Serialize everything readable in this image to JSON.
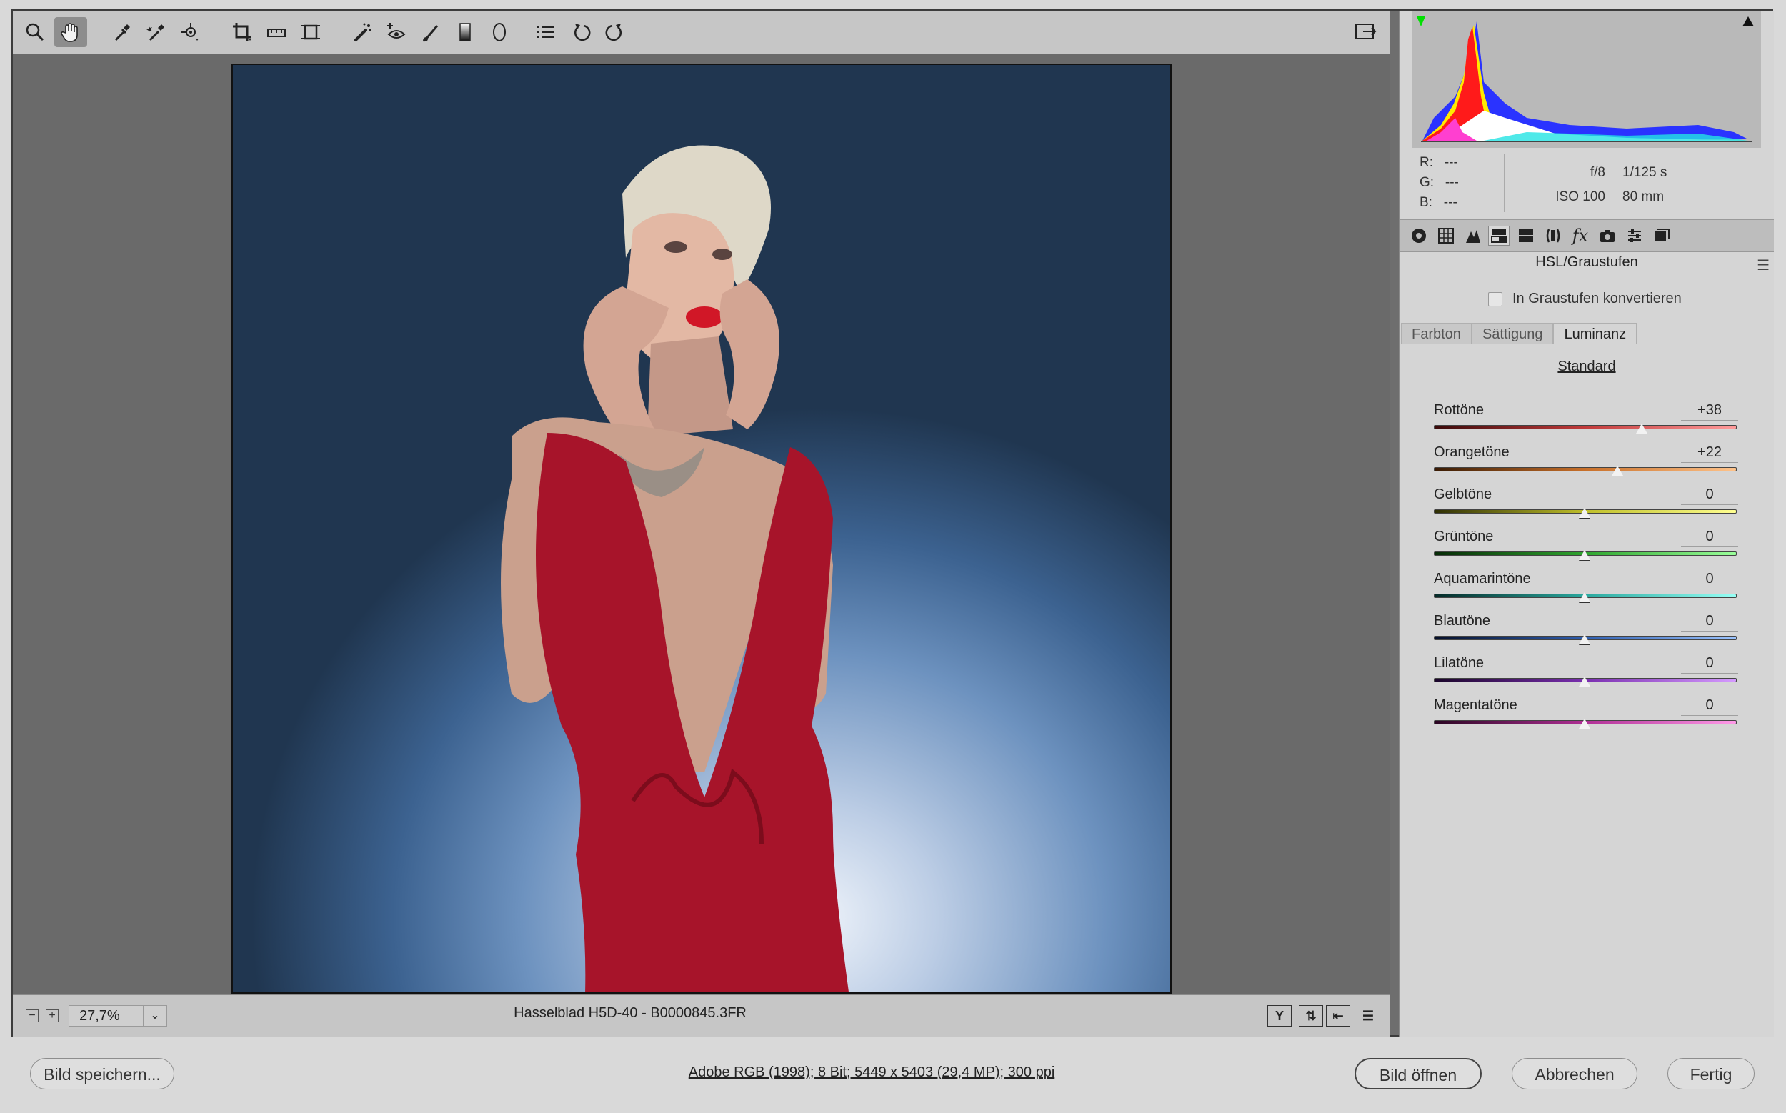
{
  "toolbar": {
    "tools": [
      {
        "icon": "zoom-icon"
      },
      {
        "icon": "hand-icon"
      },
      {
        "icon": "white-balance-icon"
      },
      {
        "icon": "color-sampler-icon"
      },
      {
        "icon": "targeted-adjustment-icon"
      },
      {
        "icon": "crop-icon"
      },
      {
        "icon": "straighten-icon"
      },
      {
        "icon": "transform-icon"
      },
      {
        "icon": "spot-removal-icon"
      },
      {
        "icon": "red-eye-icon"
      },
      {
        "icon": "adjustment-brush-icon"
      },
      {
        "icon": "graduated-filter-icon"
      },
      {
        "icon": "radial-filter-icon"
      },
      {
        "icon": "preferences-icon"
      },
      {
        "icon": "rotate-left-icon"
      },
      {
        "icon": "rotate-right-icon"
      }
    ]
  },
  "status": {
    "zoom": "27,7%",
    "filename": "Hasselblad H5D-40  -  B0000845.3FR"
  },
  "info": {
    "r_label": "R:",
    "r_val": "---",
    "g_label": "G:",
    "g_val": "---",
    "b_label": "B:",
    "b_val": "---",
    "aperture": "f/8",
    "shutter": "1/125 s",
    "iso": "ISO 100",
    "focal": "80 mm"
  },
  "panel": {
    "title": "HSL/Graustufen",
    "grayscale_label": "In Graustufen konvertieren",
    "tabs": [
      "Farbton",
      "Sättigung",
      "Luminanz"
    ],
    "active_tab": "Luminanz",
    "standard_label": "Standard",
    "sliders": [
      {
        "label": "Rottöne",
        "value": "+38",
        "amount": 38,
        "gradient": "linear-gradient(90deg,#3a0a0a,#c23a3a,#ff9a9a)"
      },
      {
        "label": "Orangetöne",
        "value": "+22",
        "amount": 22,
        "gradient": "linear-gradient(90deg,#3a1c05,#c8702a,#ffc38a)"
      },
      {
        "label": "Gelbtöne",
        "value": "0",
        "amount": 0,
        "gradient": "linear-gradient(90deg,#2f2f05,#bfbf2a,#ffff90)"
      },
      {
        "label": "Grüntöne",
        "value": "0",
        "amount": 0,
        "gradient": "linear-gradient(90deg,#062a06,#2fa52f,#9aff9a)"
      },
      {
        "label": "Aquamarintöne",
        "value": "0",
        "amount": 0,
        "gradient": "linear-gradient(90deg,#052a28,#2aa89e,#96fff5)"
      },
      {
        "label": "Blautöne",
        "value": "0",
        "amount": 0,
        "gradient": "linear-gradient(90deg,#050f2a,#2f5fb0,#9ac3ff)"
      },
      {
        "label": "Lilatöne",
        "value": "0",
        "amount": 0,
        "gradient": "linear-gradient(90deg,#1a052a,#7a2fb0,#d59aff)"
      },
      {
        "label": "Magentatöne",
        "value": "0",
        "amount": 0,
        "gradient": "linear-gradient(90deg,#2a0522,#b02f95,#ff9ae8)"
      }
    ]
  },
  "footer": {
    "save_label": "Bild speichern...",
    "color_info": "Adobe RGB (1998); 8 Bit; 5449 x 5403 (29,4 MP); 300 ppi",
    "open_label": "Bild öffnen",
    "cancel_label": "Abbrechen",
    "done_label": "Fertig"
  }
}
